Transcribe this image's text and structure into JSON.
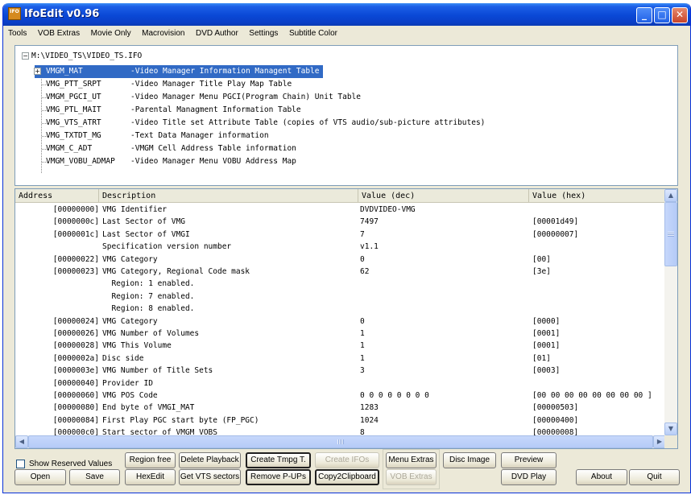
{
  "window": {
    "title": "IfoEdit v0.96",
    "icon_label": "IFO",
    "minimize_glyph": "_",
    "maximize_glyph": "□",
    "close_glyph": "✕"
  },
  "menu": [
    "Tools",
    "VOB Extras",
    "Movie Only",
    "Macrovision",
    "DVD Author",
    "Settings",
    "Subtitle Color"
  ],
  "tree": {
    "root": "M:\\VIDEO_TS\\VIDEO_TS.IFO",
    "expander_minus": "−",
    "expander_plus": "+",
    "nodes": [
      {
        "name": "VMGM_MAT",
        "desc": "-Video Manager Information Managent Table",
        "selected": true
      },
      {
        "name": "VMG_PTT_SRPT",
        "desc": "-Video Manager Title Play Map Table"
      },
      {
        "name": "VMGM_PGCI_UT",
        "desc": "-Video Manager Menu PGCI(Program Chain) Unit Table"
      },
      {
        "name": "VMG_PTL_MAIT",
        "desc": "-Parental Managment Information Table"
      },
      {
        "name": "VMG_VTS_ATRT",
        "desc": "-Video Title set Attribute Table (copies of VTS audio/sub-picture attributes)"
      },
      {
        "name": "VMG_TXTDT_MG",
        "desc": "-Text Data Manager information"
      },
      {
        "name": "VMGM_C_ADT",
        "desc": "-VMGM Cell Address Table information"
      },
      {
        "name": "VMGM_VOBU_ADMAP",
        "desc": "-Video Manager Menu VOBU Address Map"
      }
    ]
  },
  "table": {
    "columns": [
      "Address",
      "Description",
      "Value (dec)",
      "Value (hex)"
    ],
    "rows": [
      {
        "addr": "[00000000]",
        "desc": "VMG Identifier",
        "dec": "DVDVIDEO-VMG",
        "hex": ""
      },
      {
        "addr": "[0000000c]",
        "desc": "Last Sector of VMG",
        "dec": "7497",
        "hex": "[00001d49]"
      },
      {
        "addr": "[0000001c]",
        "desc": "Last Sector of VMGI",
        "dec": "7",
        "hex": "[00000007]"
      },
      {
        "addr": "",
        "desc": "Specification version number",
        "dec": "v1.1",
        "hex": ""
      },
      {
        "addr": "[00000022]",
        "desc": "VMG Category",
        "dec": "0",
        "hex": "[00]"
      },
      {
        "addr": "[00000023]",
        "desc": "VMG Category, Regional Code mask",
        "dec": "62",
        "hex": "[3e]"
      },
      {
        "addr": "",
        "desc": "  Region: 1 enabled.",
        "dec": "",
        "hex": ""
      },
      {
        "addr": "",
        "desc": "  Region: 7 enabled.",
        "dec": "",
        "hex": ""
      },
      {
        "addr": "",
        "desc": "  Region: 8 enabled.",
        "dec": "",
        "hex": ""
      },
      {
        "addr": "[00000024]",
        "desc": "VMG Category",
        "dec": "0",
        "hex": "[0000]"
      },
      {
        "addr": "[00000026]",
        "desc": "VMG Number of Volumes",
        "dec": "1",
        "hex": "[0001]"
      },
      {
        "addr": "[00000028]",
        "desc": "VMG This Volume",
        "dec": "1",
        "hex": "[0001]"
      },
      {
        "addr": "[0000002a]",
        "desc": "Disc side",
        "dec": "1",
        "hex": "[01]"
      },
      {
        "addr": "[0000003e]",
        "desc": "VMG Number of Title Sets",
        "dec": "3",
        "hex": "[0003]"
      },
      {
        "addr": "[00000040]",
        "desc": "Provider ID",
        "dec": "",
        "hex": ""
      },
      {
        "addr": "[00000060]",
        "desc": "VMG POS Code",
        "dec": "0 0 0 0 0 0 0 0",
        "hex": "[00 00 00 00 00 00 00 00 ]"
      },
      {
        "addr": "[00000080]",
        "desc": "End byte of VMGI_MAT",
        "dec": "1283",
        "hex": "[00000503]"
      },
      {
        "addr": "[00000084]",
        "desc": "First Play PGC start byte (FP_PGC)",
        "dec": "1024",
        "hex": "[00000400]"
      },
      {
        "addr": "[000000c0]",
        "desc": "Start sector of VMGM VOBS",
        "dec": "8",
        "hex": "[00000008]"
      }
    ]
  },
  "scroll": {
    "up": "▲",
    "down": "▼",
    "left": "◀",
    "right": "▶"
  },
  "controls": {
    "show_reserved_values": "Show Reserved Values",
    "region_free": "Region free",
    "delete_playback": "Delete Playback",
    "create_tmpg": "Create Tmpg T.",
    "create_ifos": "Create IFOs",
    "menu_extras": "Menu Extras",
    "disc_image": "Disc Image",
    "preview": "Preview",
    "open": "Open",
    "save": "Save",
    "hexedit": "HexEdit",
    "get_vts_sectors": "Get VTS sectors",
    "remove_pups": "Remove P-UPs",
    "copy2clipboard": "Copy2Clipboard",
    "vob_extras": "VOB Extras",
    "dvd_play": "DVD Play",
    "about": "About",
    "quit": "Quit"
  },
  "colors": {
    "titlebar": "#0a48d6",
    "selection": "#316ac5",
    "window_bg": "#ece9d8"
  }
}
